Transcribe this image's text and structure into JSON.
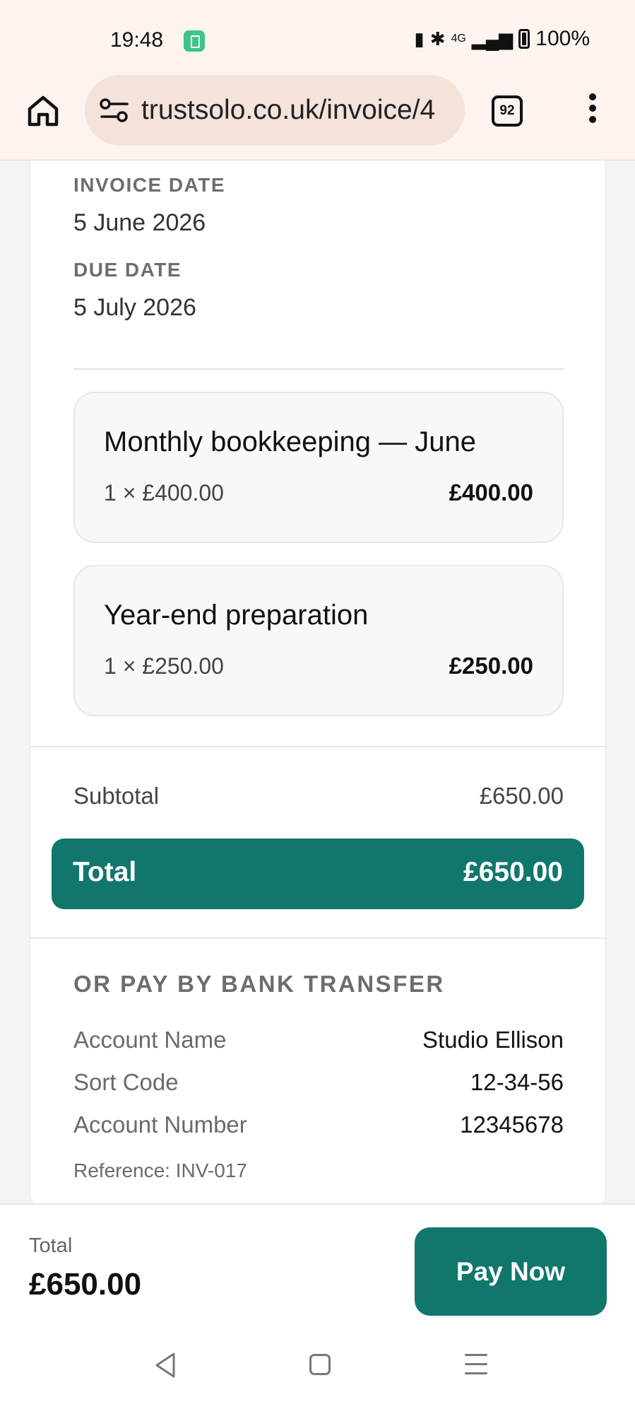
{
  "status_bar": {
    "time": "19:48",
    "network": "4G",
    "battery": "100%"
  },
  "browser": {
    "url": "trustsolo.co.uk/invoice/4",
    "tab_count": "92"
  },
  "invoice": {
    "invoice_date_label": "INVOICE DATE",
    "invoice_date": "5 June 2026",
    "due_date_label": "DUE DATE",
    "due_date": "5 July 2026",
    "line_items": [
      {
        "description": "Monthly bookkeeping — June",
        "quantity": "1 × £400.00",
        "amount": "£400.00"
      },
      {
        "description": "Year-end preparation",
        "quantity": "1 × £250.00",
        "amount": "£250.00"
      }
    ],
    "subtotal_label": "Subtotal",
    "subtotal": "£650.00",
    "total_label": "Total",
    "total": "£650.00"
  },
  "bank_transfer": {
    "heading": "OR PAY BY BANK TRANSFER",
    "rows": [
      {
        "label": "Account Name",
        "value": "Studio Ellison"
      },
      {
        "label": "Sort Code",
        "value": "12-34-56"
      },
      {
        "label": "Account Number",
        "value": "12345678"
      }
    ],
    "reference": "Reference: INV-017"
  },
  "pay_bar": {
    "label": "Total",
    "total": "£650.00",
    "button_label": "Pay Now"
  },
  "colors": {
    "accent": "#11766c",
    "chrome_background": "#fdf3ef",
    "url_bar_background": "#f4e3db"
  }
}
